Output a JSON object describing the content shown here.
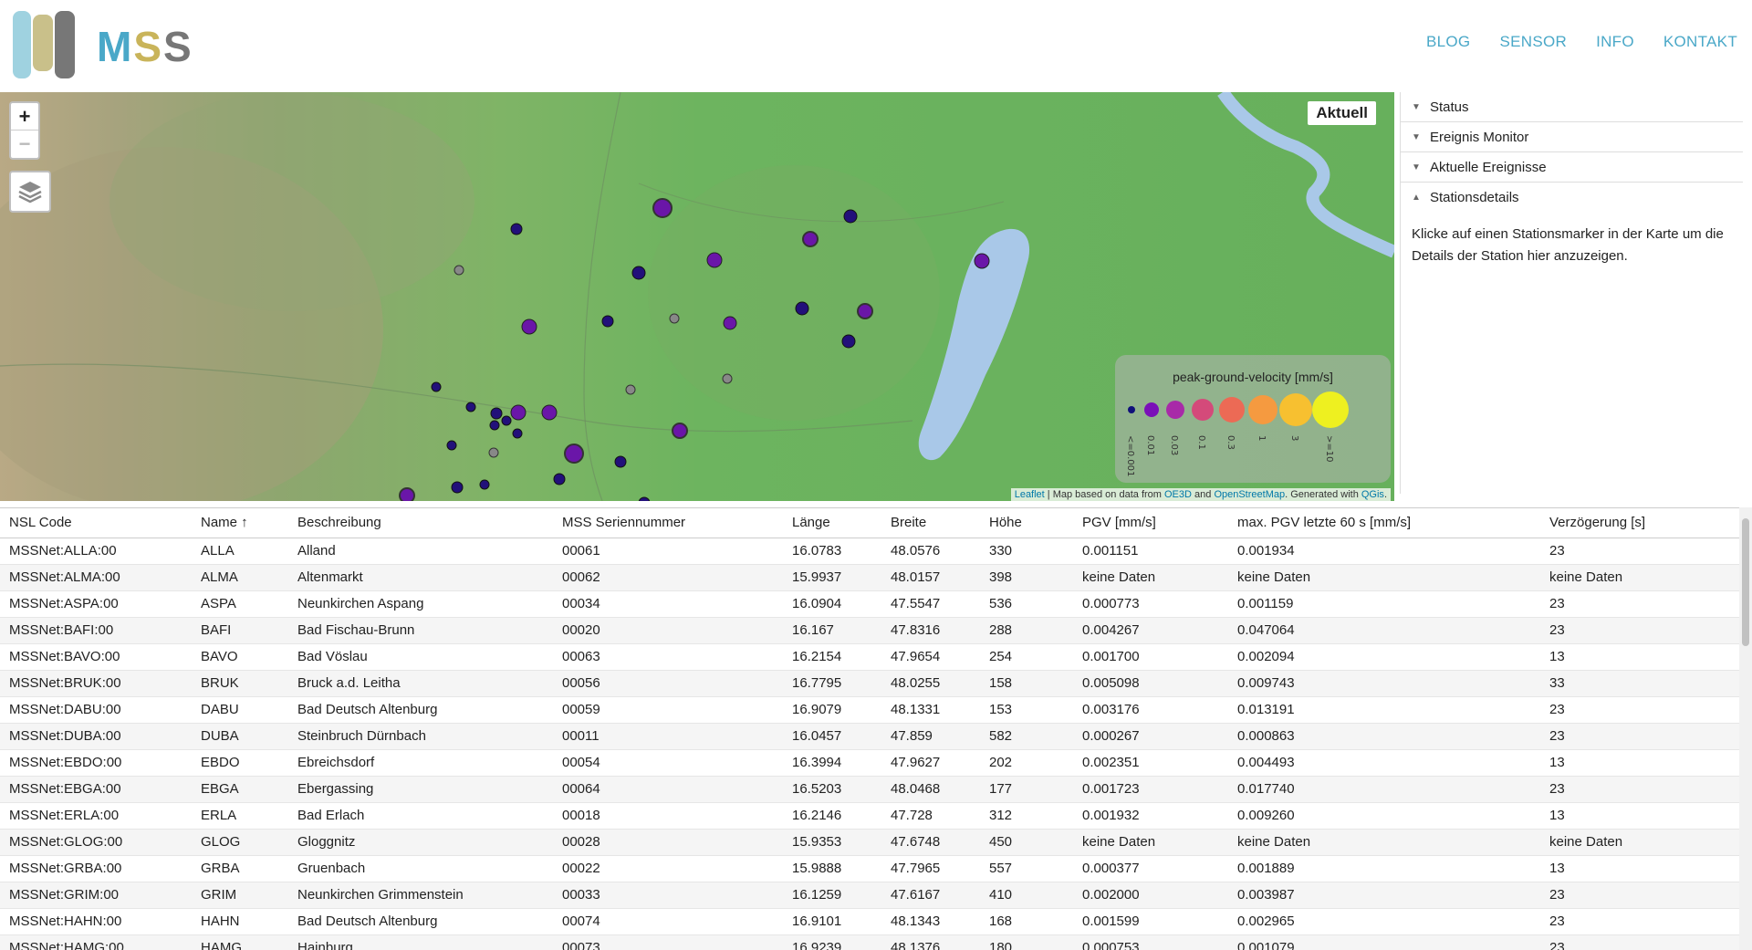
{
  "brand": {
    "name": "MSS"
  },
  "nav": [
    {
      "label": "BLOG"
    },
    {
      "label": "SENSOR"
    },
    {
      "label": "INFO"
    },
    {
      "label": "KONTAKT"
    }
  ],
  "map": {
    "zoom_in": "+",
    "zoom_out": "−",
    "mode_label": "Aktuell",
    "legend": {
      "title": "peak-ground-velocity [mm/s]",
      "steps": [
        {
          "label": "<=0.001",
          "color": "#10107a"
        },
        {
          "label": "0.01",
          "color": "#7a10b8"
        },
        {
          "label": "0.03",
          "color": "#a82aa8"
        },
        {
          "label": "0.1",
          "color": "#d44a7a"
        },
        {
          "label": "0.3",
          "color": "#ec6a55"
        },
        {
          "label": "1",
          "color": "#f59a40"
        },
        {
          "label": "3",
          "color": "#f7c030"
        },
        {
          "label": ">=10",
          "color": "#eef020"
        }
      ]
    },
    "attribution": {
      "leaflet": "Leaflet",
      "text1": " | Map based on data from ",
      "oe3d": "OE3D",
      "text2": " and ",
      "osm": "OpenStreetMap",
      "text3": ". Generated with ",
      "qgis": "QGis",
      "text4": "."
    }
  },
  "panel": {
    "sections": [
      {
        "label": "Status",
        "caret": "▼"
      },
      {
        "label": "Ereignis Monitor",
        "caret": "▼"
      },
      {
        "label": "Aktuelle Ereignisse",
        "caret": "▼"
      },
      {
        "label": "Stationsdetails",
        "caret": "▲"
      }
    ],
    "description": "Klicke auf einen Stationsmarker in der Karte um die Details der Station hier anzuzeigen."
  },
  "table": {
    "columns": [
      "NSL Code",
      "Name ↑",
      "Beschreibung",
      "MSS Seriennummer",
      "Länge",
      "Breite",
      "Höhe",
      "PGV [mm/s]",
      "max. PGV letzte 60 s [mm/s]",
      "Verzögerung [s]"
    ],
    "rows": [
      [
        "MSSNet:ALLA:00",
        "ALLA",
        "Alland",
        "00061",
        "16.0783",
        "48.0576",
        "330",
        "0.001151",
        "0.001934",
        "23"
      ],
      [
        "MSSNet:ALMA:00",
        "ALMA",
        "Altenmarkt",
        "00062",
        "15.9937",
        "48.0157",
        "398",
        "keine Daten",
        "keine Daten",
        "keine Daten"
      ],
      [
        "MSSNet:ASPA:00",
        "ASPA",
        "Neunkirchen Aspang",
        "00034",
        "16.0904",
        "47.5547",
        "536",
        "0.000773",
        "0.001159",
        "23"
      ],
      [
        "MSSNet:BAFI:00",
        "BAFI",
        "Bad Fischau-Brunn",
        "00020",
        "16.167",
        "47.8316",
        "288",
        "0.004267",
        "0.047064",
        "23"
      ],
      [
        "MSSNet:BAVO:00",
        "BAVO",
        "Bad Vöslau",
        "00063",
        "16.2154",
        "47.9654",
        "254",
        "0.001700",
        "0.002094",
        "13"
      ],
      [
        "MSSNet:BRUK:00",
        "BRUK",
        "Bruck a.d. Leitha",
        "00056",
        "16.7795",
        "48.0255",
        "158",
        "0.005098",
        "0.009743",
        "33"
      ],
      [
        "MSSNet:DABU:00",
        "DABU",
        "Bad Deutsch Altenburg",
        "00059",
        "16.9079",
        "48.1331",
        "153",
        "0.003176",
        "0.013191",
        "23"
      ],
      [
        "MSSNet:DUBA:00",
        "DUBA",
        "Steinbruch Dürnbach",
        "00011",
        "16.0457",
        "47.859",
        "582",
        "0.000267",
        "0.000863",
        "23"
      ],
      [
        "MSSNet:EBDO:00",
        "EBDO",
        "Ebreichsdorf",
        "00054",
        "16.3994",
        "47.9627",
        "202",
        "0.002351",
        "0.004493",
        "13"
      ],
      [
        "MSSNet:EBGA:00",
        "EBGA",
        "Ebergassing",
        "00064",
        "16.5203",
        "48.0468",
        "177",
        "0.001723",
        "0.017740",
        "23"
      ],
      [
        "MSSNet:ERLA:00",
        "ERLA",
        "Bad Erlach",
        "00018",
        "16.2146",
        "47.728",
        "312",
        "0.001932",
        "0.009260",
        "13"
      ],
      [
        "MSSNet:GLOG:00",
        "GLOG",
        "Gloggnitz",
        "00028",
        "15.9353",
        "47.6748",
        "450",
        "keine Daten",
        "keine Daten",
        "keine Daten"
      ],
      [
        "MSSNet:GRBA:00",
        "GRBA",
        "Gruenbach",
        "00022",
        "15.9888",
        "47.7965",
        "557",
        "0.000377",
        "0.001889",
        "13"
      ],
      [
        "MSSNet:GRIM:00",
        "GRIM",
        "Neunkirchen Grimmenstein",
        "00033",
        "16.1259",
        "47.6167",
        "410",
        "0.002000",
        "0.003987",
        "23"
      ],
      [
        "MSSNet:HAHN:00",
        "HAHN",
        "Bad Deutsch Altenburg",
        "00074",
        "16.9101",
        "48.1343",
        "168",
        "0.001599",
        "0.002965",
        "23"
      ],
      [
        "MSSNet:HAMG:00",
        "HAMG",
        "Hainburg",
        "00073",
        "16.9239",
        "48.1376",
        "180",
        "0.000753",
        "0.001079",
        "23"
      ]
    ]
  },
  "colors": {
    "accent": "#4aa8c8",
    "water": "#a9c8e8"
  }
}
